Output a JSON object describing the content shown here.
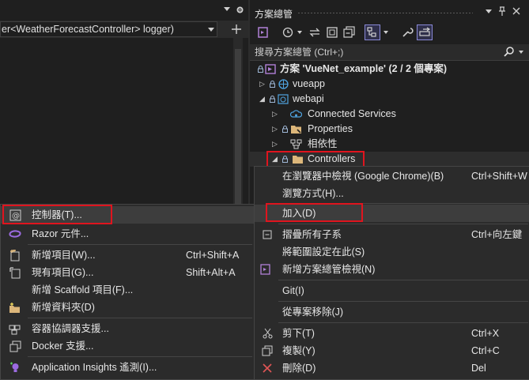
{
  "editor": {
    "nav_dropdown_text": "er<WeatherForecastController> logger)"
  },
  "solution_explorer": {
    "title": "方案總管",
    "pin_glyph": "ᛘ",
    "close_glyph": "✕",
    "search_placeholder": "搜尋方案總管 (Ctrl+;)",
    "tree": [
      {
        "label": "方案 'VueNet_example' (2 / 2 個專案)",
        "bold": true
      },
      {
        "label": "vueapp"
      },
      {
        "label": "webapi"
      },
      {
        "label": "Connected Services"
      },
      {
        "label": "Properties"
      },
      {
        "label": "相依性"
      },
      {
        "label": "Controllers"
      }
    ]
  },
  "right_menu": {
    "items": [
      {
        "label": "在瀏覽器中檢視 (Google Chrome)(B)",
        "shortcut": "Ctrl+Shift+W"
      },
      {
        "label": "瀏覽方式(H)..."
      },
      {
        "label": "加入(D)"
      },
      {
        "label": "摺疊所有子系",
        "shortcut": "Ctrl+向左鍵"
      },
      {
        "label": "將範圍設定在此(S)"
      },
      {
        "label": "新增方案總管檢視(N)"
      },
      {
        "label": "Git(I)"
      },
      {
        "label": "從專案移除(J)"
      },
      {
        "label": "剪下(T)",
        "shortcut": "Ctrl+X"
      },
      {
        "label": "複製(Y)",
        "shortcut": "Ctrl+C"
      },
      {
        "label": "刪除(D)",
        "shortcut": "Del"
      }
    ]
  },
  "add_menu": {
    "items": [
      {
        "label": "控制器(T)..."
      },
      {
        "label": "Razor 元件..."
      },
      {
        "label": "新增項目(W)...",
        "shortcut": "Ctrl+Shift+A"
      },
      {
        "label": "現有項目(G)...",
        "shortcut": "Shift+Alt+A"
      },
      {
        "label": "新增 Scaffold 項目(F)..."
      },
      {
        "label": "新增資料夾(D)"
      },
      {
        "label": "容器協調器支援..."
      },
      {
        "label": "Docker 支援..."
      },
      {
        "label": "Application Insights 遙測(I)..."
      }
    ]
  },
  "colors": {
    "highlight_box": "#e0141e",
    "accent_purple": "#8a8ad8",
    "folder": "#dcb67a"
  }
}
